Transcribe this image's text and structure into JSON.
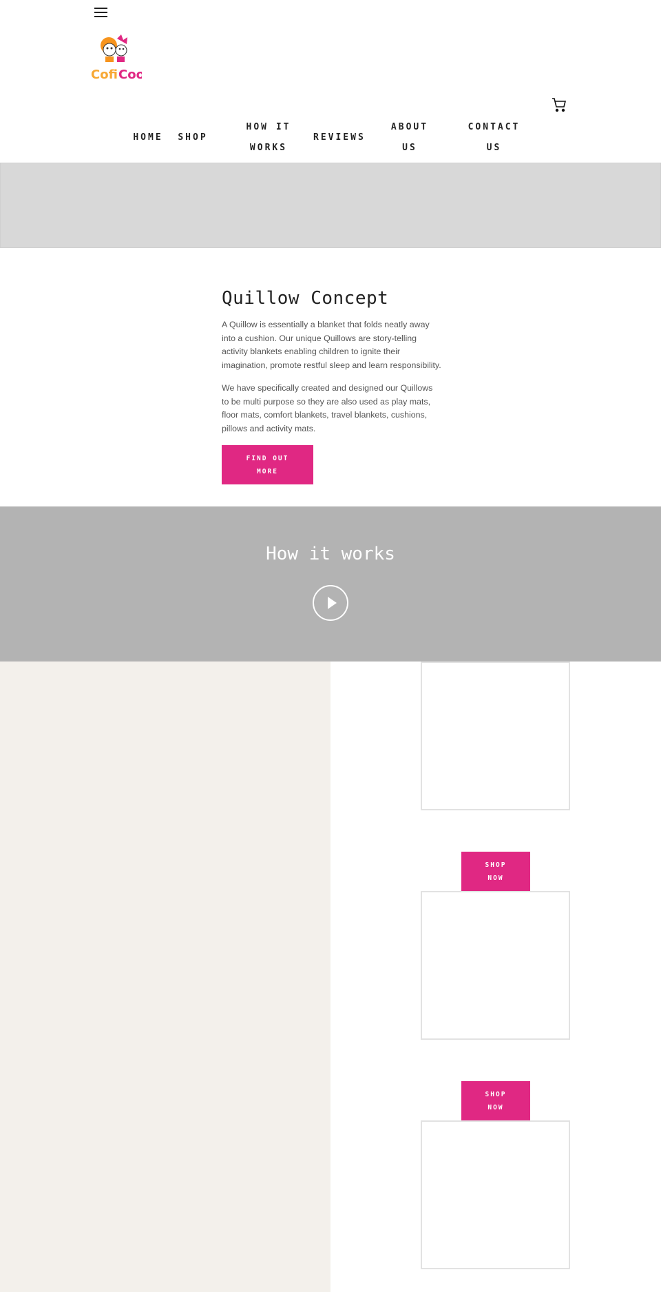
{
  "header": {
    "menu_icon": "hamburger-menu-icon",
    "logo_text": "CofiCoo",
    "cart_icon": "shopping-cart-icon"
  },
  "nav": {
    "items": [
      {
        "label": "HOME"
      },
      {
        "label": "SHOP"
      },
      {
        "label": "HOW IT WORKS"
      },
      {
        "label": "REVIEWS"
      },
      {
        "label": "ABOUT US"
      },
      {
        "label": "CONTACT US"
      }
    ]
  },
  "concept": {
    "title": "Quillow Concept",
    "paragraph1": "A Quillow is essentially a blanket that folds neatly away into a cushion.  Our unique Quillows are story-telling activity blankets enabling children to ignite their imagination, promote restful sleep and learn responsibility.",
    "paragraph2": "We have specifically created and designed our Quillows to be multi purpose so they are also used as play mats, floor mats, comfort blankets, travel blankets, cushions, pillows and activity mats.",
    "button_label": "FIND OUT MORE"
  },
  "how_it_works": {
    "title": "How it works",
    "play_icon": "play-icon"
  },
  "products": {
    "shop_button_label": "SHOP NOW"
  },
  "colors": {
    "accent": "#e02883",
    "hero_gray": "#d8d8d8",
    "video_gray": "#b3b3b3",
    "panel_beige": "#f3f0eb"
  }
}
